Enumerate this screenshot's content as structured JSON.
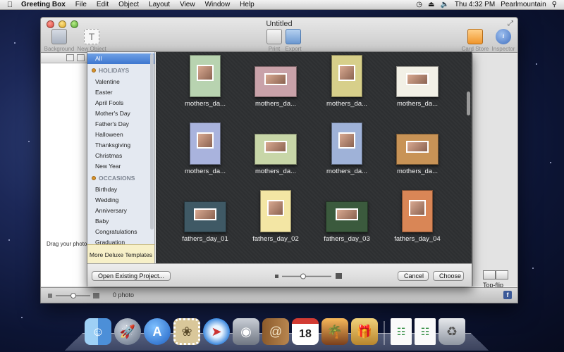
{
  "menubar": {
    "app_name": "Greeting Box",
    "items": [
      "File",
      "Edit",
      "Object",
      "Layout",
      "View",
      "Window",
      "Help"
    ],
    "clock": "Thu 4:32 PM",
    "user": "Pearlmountain"
  },
  "window": {
    "title": "Untitled",
    "toolbar": {
      "background": "Background",
      "new_object": "New Object",
      "print": "Print",
      "export": "Export",
      "card_store": "Card Store",
      "inspector": "Inspector"
    },
    "drag_hint": "Drag your photos",
    "photo_count": "0 photo",
    "top_flip": "Top-flip"
  },
  "sheet": {
    "categories": {
      "all": "All",
      "holidays_header": "HOLIDAYS",
      "holidays": [
        "Valentine",
        "Easter",
        "April Fools",
        "Mother's Day",
        "Father's Day",
        "Halloween",
        "Thanksgiving",
        "Christmas",
        "New Year"
      ],
      "occasions_header": "OCCASIONS",
      "occasions": [
        "Birthday",
        "Wedding",
        "Anniversary",
        "Baby",
        "Congratulations",
        "Graduation"
      ]
    },
    "deluxe": "More Deluxe Templates",
    "templates": [
      {
        "name": "mothers_da...",
        "color": "#b8d3b0"
      },
      {
        "name": "mothers_da...",
        "color": "#c9a2a9"
      },
      {
        "name": "mothers_da...",
        "color": "#d7cf8a"
      },
      {
        "name": "mothers_da...",
        "color": "#f2f0e6"
      },
      {
        "name": "mothers_da...",
        "color": "#a9b3dd"
      },
      {
        "name": "mothers_da...",
        "color": "#c8d6a8"
      },
      {
        "name": "mothers_da...",
        "color": "#9fb2d8"
      },
      {
        "name": "mothers_da...",
        "color": "#c89356"
      },
      {
        "name": "fathers_day_01",
        "color": "#3f5965"
      },
      {
        "name": "fathers_day_02",
        "color": "#f3e6a4"
      },
      {
        "name": "fathers_day_03",
        "color": "#3b5a3d"
      },
      {
        "name": "fathers_day_04",
        "color": "#d98656"
      }
    ],
    "buttons": {
      "open_existing": "Open Existing Project...",
      "cancel": "Cancel",
      "choose": "Choose"
    }
  },
  "dock": {
    "icons": [
      "finder-icon",
      "launchpad-icon",
      "app-store-icon",
      "stamp-app-icon",
      "safari-icon",
      "facetime-icon",
      "address-book-icon",
      "calendar-icon",
      "iphoto-icon",
      "greeting-box-icon",
      "document-icon",
      "document-icon",
      "trash-icon"
    ],
    "calendar_day": "18"
  }
}
